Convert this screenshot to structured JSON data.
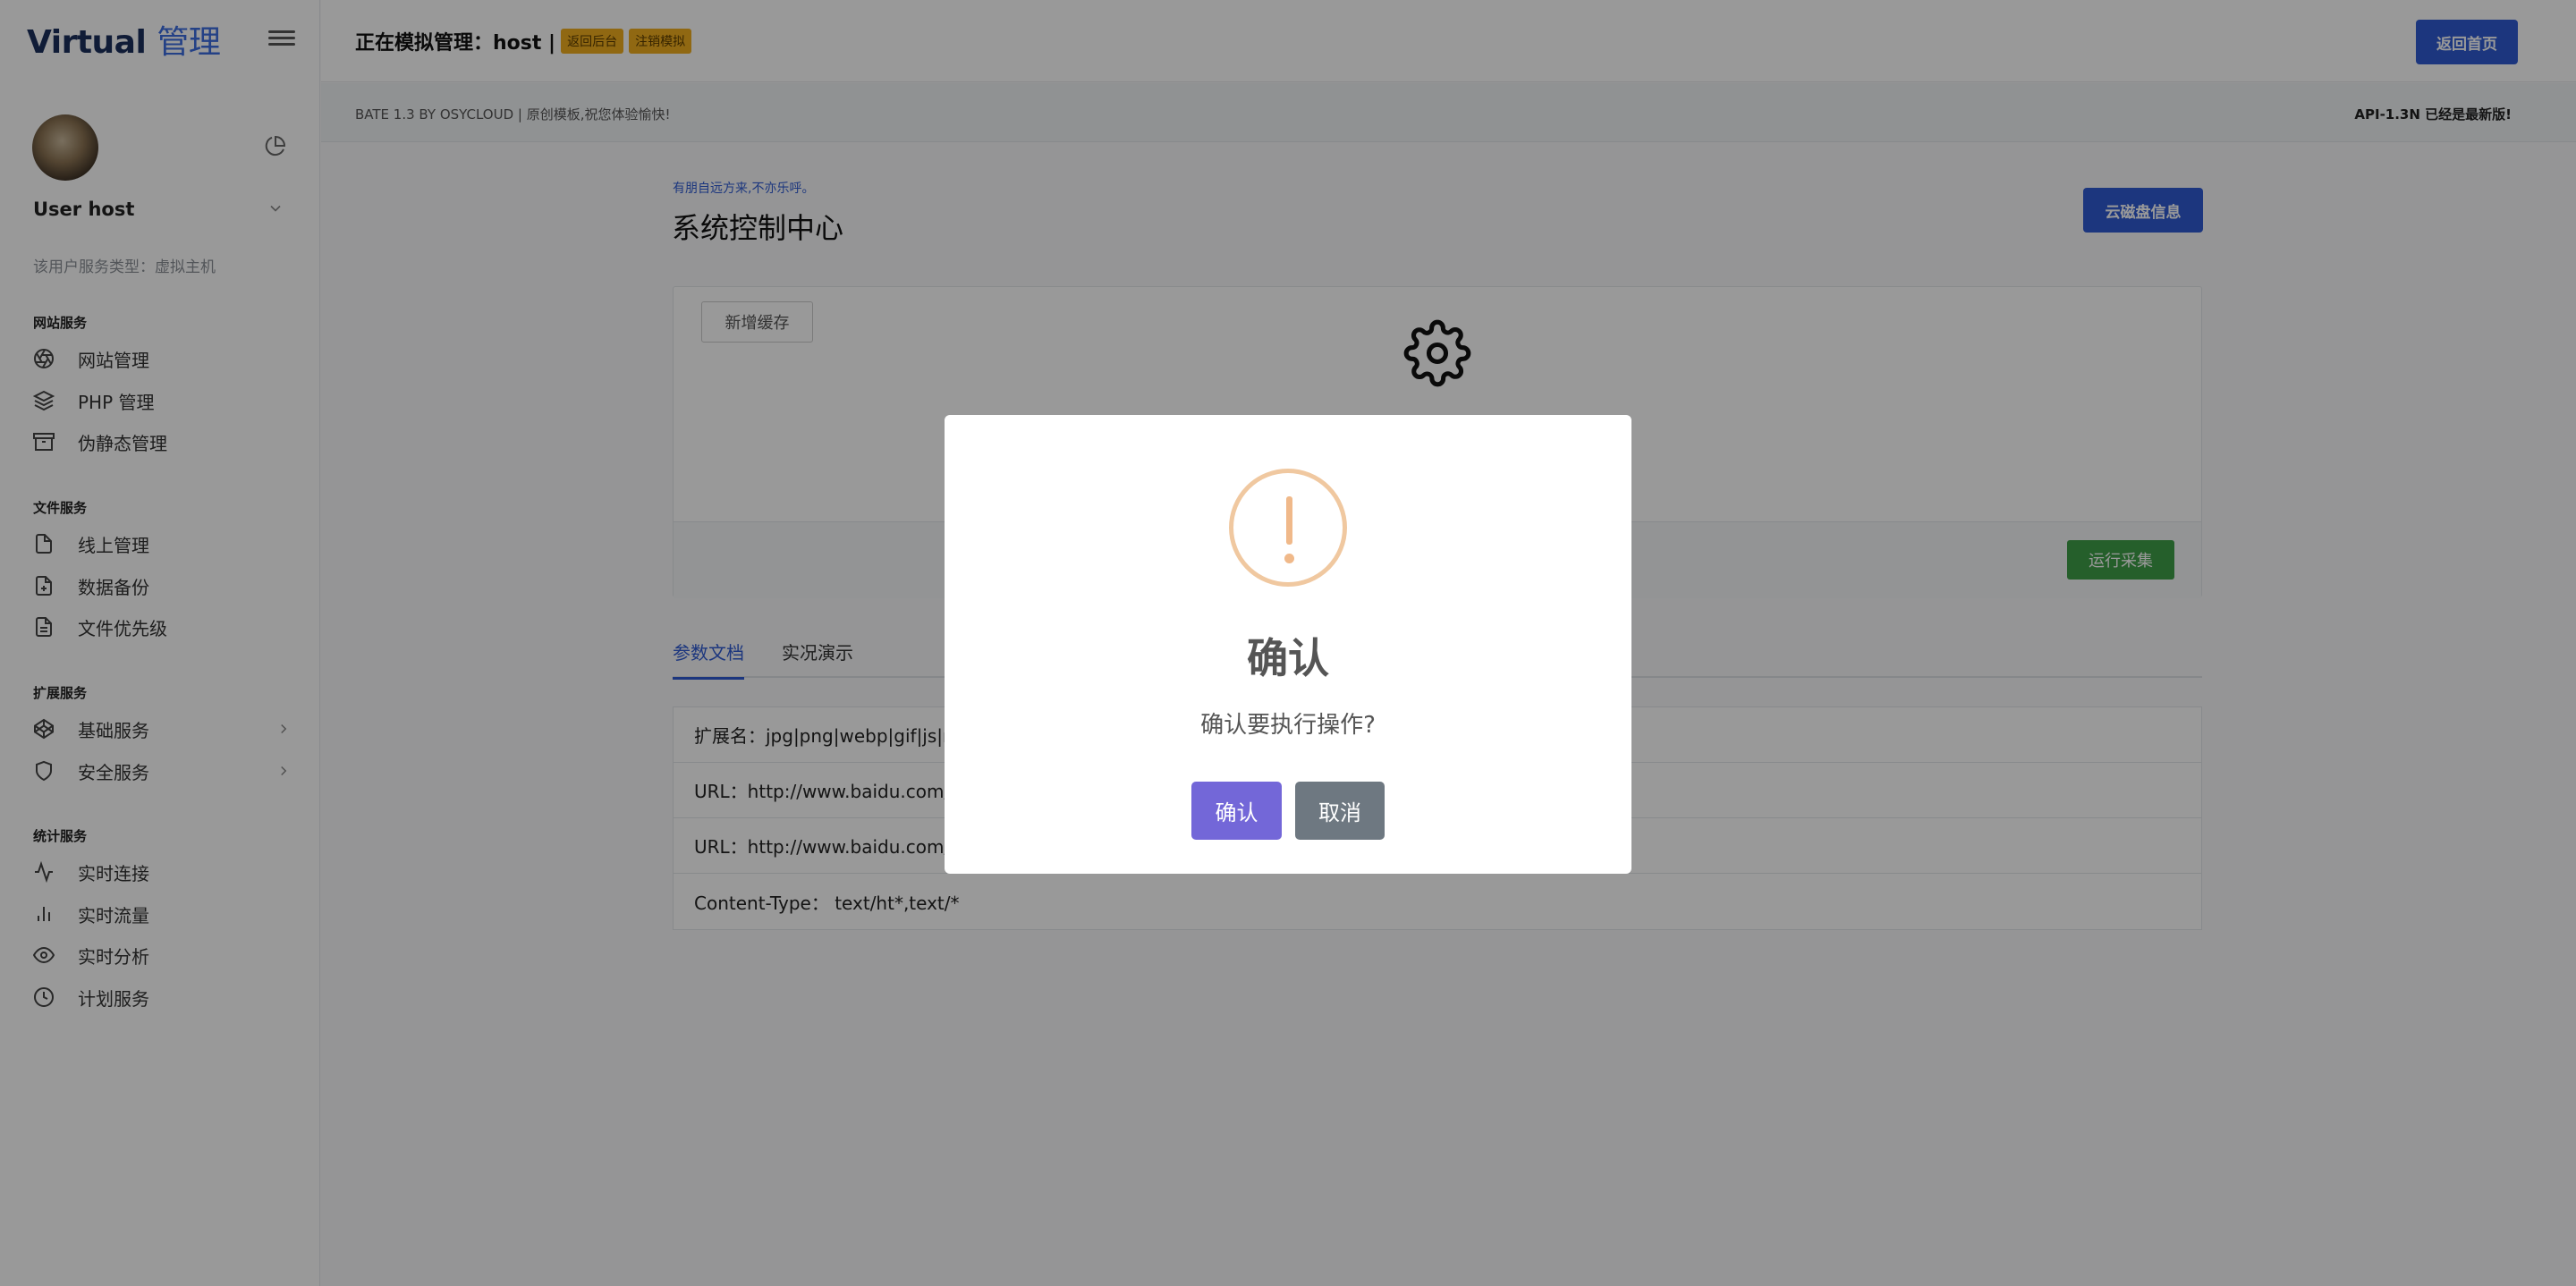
{
  "brand": {
    "name": "Virtual",
    "suffix": "管理"
  },
  "user": {
    "name": "User host",
    "type": "该用户服务类型：虚拟主机"
  },
  "sidebar": {
    "sections": [
      {
        "title": "网站服务",
        "items": [
          {
            "label": "网站管理",
            "icon": "aperture-icon"
          },
          {
            "label": "PHP 管理",
            "icon": "layers-icon"
          },
          {
            "label": "伪静态管理",
            "icon": "archive-icon"
          }
        ]
      },
      {
        "title": "文件服务",
        "items": [
          {
            "label": "线上管理",
            "icon": "file-icon"
          },
          {
            "label": "数据备份",
            "icon": "file-plus-icon"
          },
          {
            "label": "文件优先级",
            "icon": "file-text-icon"
          }
        ]
      },
      {
        "title": "扩展服务",
        "items": [
          {
            "label": "基础服务",
            "icon": "codepen-icon"
          },
          {
            "label": "安全服务",
            "icon": "shield-icon"
          }
        ]
      },
      {
        "title": "统计服务",
        "items": [
          {
            "label": "实时连接",
            "icon": "activity-icon"
          },
          {
            "label": "实时流量",
            "icon": "bar-chart-icon"
          },
          {
            "label": "实时分析",
            "icon": "eye-icon"
          },
          {
            "label": "计划服务",
            "icon": "clock-icon"
          }
        ]
      }
    ]
  },
  "topbar": {
    "title": "正在模拟管理：host |",
    "tag_back": "返回后台",
    "tag_logout": "注销模拟",
    "home_button": "返回首页"
  },
  "subbar": {
    "left": "BATE 1.3 BY OSYCLOUD | 原创模板,祝您体验愉快!",
    "right": "API-1.3N 已经是最新版!"
  },
  "main": {
    "tagline": "有朋自远方来,不亦乐呼。",
    "title": "系统控制中心",
    "cloud_button": "云磁盘信息",
    "cache_button": "新增缓存",
    "run_button": "运行采集",
    "tabs": [
      {
        "label": "参数文档",
        "active": true
      },
      {
        "label": "实况演示",
        "active": false
      }
    ],
    "doc_rows": [
      "扩展名：jpg|png|webp|gif|js|m",
      "URL：http://www.baidu.com/",
      "URL：http://www.baidu.com/",
      "Content-Type： text/ht*,text/*"
    ]
  },
  "dialog": {
    "title": "确认",
    "text": "确认要执行操作?",
    "confirm": "确认",
    "cancel": "取消"
  },
  "colors": {
    "accent": "#2f5bd3",
    "success": "#3f9e48",
    "confirm": "#7367d8",
    "cancel": "#6e7881",
    "warning": "#f0c8a0"
  }
}
